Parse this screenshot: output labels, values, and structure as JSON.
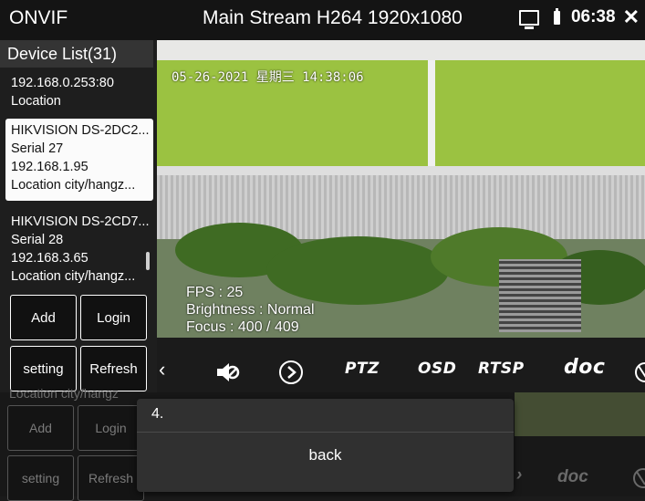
{
  "statusbar": {
    "app_title": "ONVIF",
    "stream_title": "Main Stream H264 1920x1080",
    "time": "06:38"
  },
  "sidebar": {
    "header": "Device List(31)",
    "items": [
      {
        "lines": [
          "192.168.0.253:80",
          "Location"
        ]
      },
      {
        "lines": [
          "HIKVISION DS-2DC2...",
          "Serial  27",
          "192.168.1.95",
          "Location  city/hangz..."
        ]
      },
      {
        "lines": [
          "HIKVISION DS-2CD7...",
          "Serial  28",
          "192.168.3.65",
          "Location  city/hangz..."
        ]
      }
    ],
    "buttons": {
      "add": "Add",
      "login": "Login",
      "setting": "setting",
      "refresh": "Refresh"
    }
  },
  "video": {
    "timestamp": "05-26-2021 星期三 14:38:06",
    "fps": "FPS : 25",
    "brightness": "Brightness : Normal",
    "focus": "Focus : 400 / 409"
  },
  "toolbar": {
    "ptz": "PTZ",
    "osd": "OSD",
    "rtsp": "RTSP",
    "doc": "doc"
  },
  "ghost": {
    "location": "Location  city/hangz",
    "add": "Add",
    "login": "Login",
    "setting": "setting",
    "refresh": "Refresh",
    "doc": "doc"
  },
  "dialog": {
    "title": "4.",
    "back": "back"
  }
}
